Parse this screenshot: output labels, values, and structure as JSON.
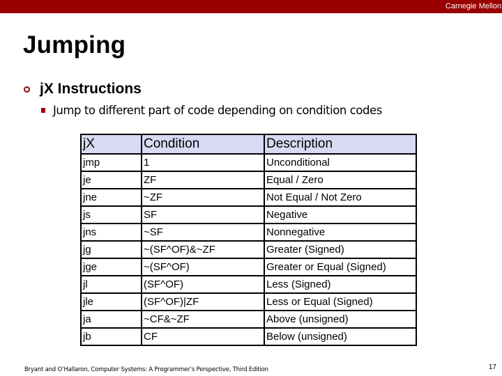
{
  "header": {
    "brand": "Carnegie Mellon",
    "bar_color": "#990000"
  },
  "slide": {
    "title": "Jumping",
    "bullet_l1": "jX Instructions",
    "bullet_l2": "Jump to different part of code depending on condition codes"
  },
  "table": {
    "header_bg": "#d9d9f3",
    "columns": [
      "jX",
      "Condition",
      "Description"
    ],
    "rows": [
      [
        "jmp",
        "1",
        "Unconditional"
      ],
      [
        "je",
        "ZF",
        "Equal / Zero"
      ],
      [
        "jne",
        "~ZF",
        "Not Equal / Not Zero"
      ],
      [
        "js",
        "SF",
        "Negative"
      ],
      [
        "jns",
        "~SF",
        "Nonnegative"
      ],
      [
        "jg",
        "~(SF^OF)&~ZF",
        "Greater (Signed)"
      ],
      [
        "jge",
        "~(SF^OF)",
        "Greater or Equal (Signed)"
      ],
      [
        "jl",
        "(SF^OF)",
        "Less (Signed)"
      ],
      [
        "jle",
        "(SF^OF)|ZF",
        "Less or Equal (Signed)"
      ],
      [
        "ja",
        "~CF&~ZF",
        "Above (unsigned)"
      ],
      [
        "jb",
        "CF",
        "Below (unsigned)"
      ]
    ]
  },
  "footer": {
    "citation": "Bryant and O’Hallaron, Computer Systems: A Programmer’s Perspective, Third Edition",
    "page_number": "17"
  }
}
